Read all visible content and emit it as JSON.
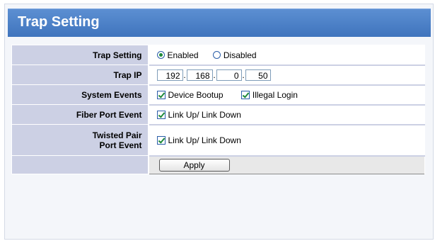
{
  "page": {
    "title": "Trap Setting"
  },
  "form": {
    "trap_setting": {
      "label": "Trap Setting",
      "options": [
        {
          "label": "Enabled",
          "selected": true
        },
        {
          "label": "Disabled",
          "selected": false
        }
      ]
    },
    "trap_ip": {
      "label": "Trap IP",
      "octets": [
        "192",
        "168",
        "0",
        "50"
      ]
    },
    "system_events": {
      "label": "System Events",
      "options": [
        {
          "label": "Device Bootup",
          "checked": true
        },
        {
          "label": "Illegal Login",
          "checked": true
        }
      ]
    },
    "fiber_port_event": {
      "label": "Fiber Port Event",
      "option": {
        "label": "Link Up/ Link Down",
        "checked": true
      }
    },
    "twisted_pair_port_event": {
      "label_line1": "Twisted Pair",
      "label_line2": "Port Event",
      "option": {
        "label": "Link Up/ Link Down",
        "checked": true
      }
    },
    "apply_label": "Apply"
  },
  "colors": {
    "title_bar": "#4a80c8",
    "label_cell": "#ccd0e4",
    "check_mark": "#1f8a3a"
  }
}
